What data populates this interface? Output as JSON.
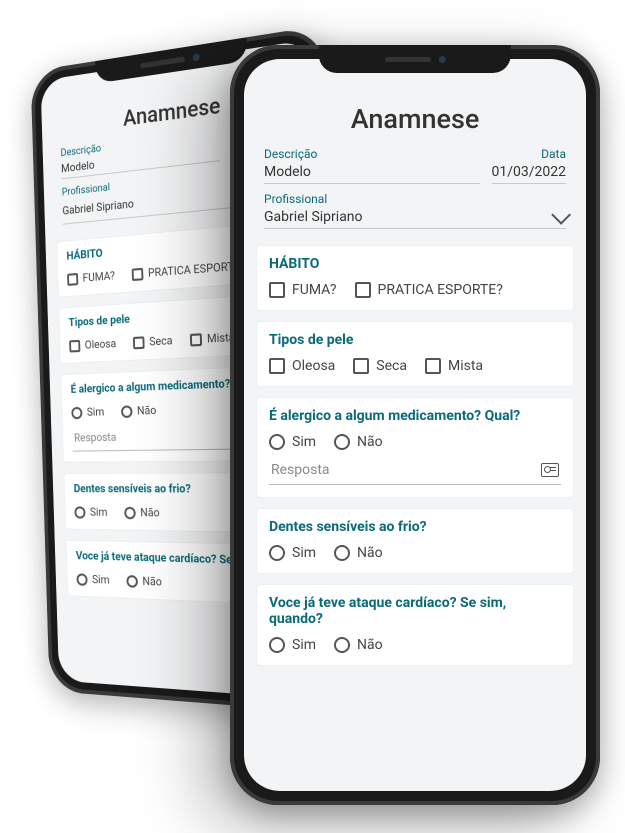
{
  "title": "Anamnese",
  "labels": {
    "descricao": "Descrição",
    "data": "Data",
    "profissional": "Profissional"
  },
  "values": {
    "descricao": "Modelo",
    "data": "01/03/2022",
    "profissional": "Gabriel Sipriano"
  },
  "answer_placeholder": "Resposta",
  "questions": {
    "habito": {
      "title": "HÁBITO",
      "options": [
        "FUMA?",
        "PRATICA ESPORTE?"
      ]
    },
    "pele": {
      "title": "Tipos de pele",
      "options": [
        "Oleosa",
        "Seca",
        "Mista"
      ]
    },
    "alergia": {
      "title": "É alergico a algum medicamento? Qual?",
      "options": [
        "Sim",
        "Não"
      ]
    },
    "dentes": {
      "title": "Dentes sensíveis ao frio?",
      "options": [
        "Sim",
        "Não"
      ]
    },
    "cardiaco": {
      "title": "Voce já teve ataque cardíaco? Se sim, quando?",
      "options": [
        "Sim",
        "Não"
      ]
    }
  }
}
